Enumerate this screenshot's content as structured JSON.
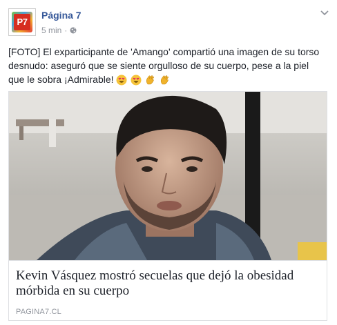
{
  "post": {
    "page_name": "Página 7",
    "avatar_text": "P7",
    "time": "5 min",
    "separator": "·",
    "text": "[FOTO] El exparticipante de 'Amango' compartió una imagen de su torso desnudo: aseguró que se siente orgulloso de su cuerpo, pese a la piel que le sobra ¡Admirable!",
    "emojis": [
      "heart-eyes-emoji",
      "heart-eyes-emoji",
      "clapping-hands-emoji",
      "clapping-hands-emoji"
    ]
  },
  "link": {
    "title": "Kevin Vásquez mostró secuelas que dejó la obesidad mórbida en su cuerpo",
    "domain": "PAGINA7.CL"
  },
  "colors": {
    "page_name": "#365899",
    "meta": "#90949c",
    "text": "#1d2129",
    "border": "#dddfe2"
  }
}
